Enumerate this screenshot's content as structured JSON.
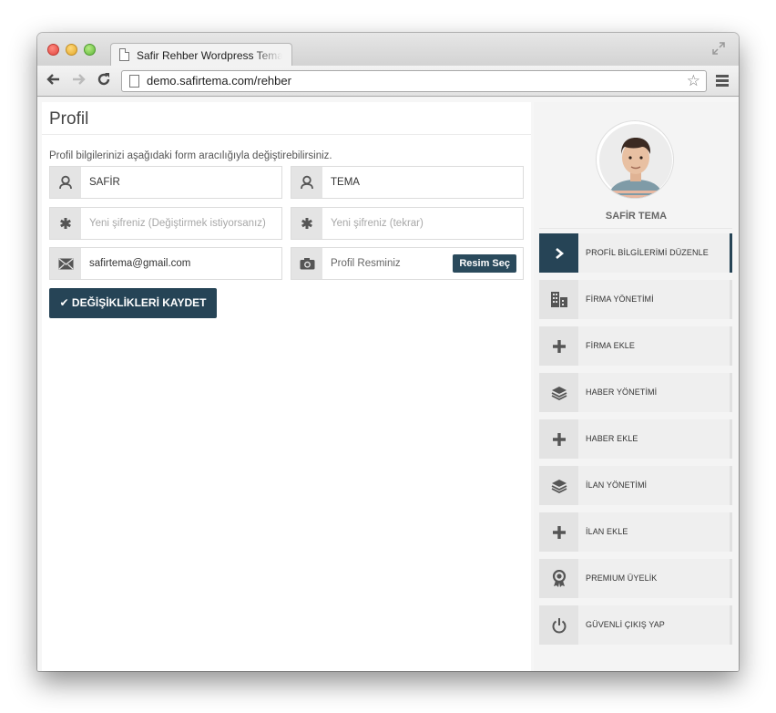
{
  "browser": {
    "tab_title": "Safir Rehber Wordpress Temas",
    "url": "demo.safirtema.com/rehber"
  },
  "profile": {
    "title": "Profil",
    "intro": "Profil bilgilerinizi aşağıdaki form aracılığıyla değiştirebilirsiniz.",
    "first_name": "SAFİR",
    "last_name": "TEMA",
    "password_placeholder": "Yeni şifreniz (Değiştirmek istiyorsanız)",
    "password_repeat_placeholder": "Yeni şifreniz (tekrar)",
    "email": "safirtema@gmail.com",
    "avatar_placeholder": "Profil Resminiz",
    "choose_image_label": "Resim Seç",
    "save_label": "✔ DEĞİŞİKLİKLERİ KAYDET"
  },
  "sidebar": {
    "user_name": "SAFİR TEMA",
    "items": [
      {
        "label": "PROFİL BİLGİLERİMİ DÜZENLE",
        "icon": "chevron-right-icon",
        "active": true
      },
      {
        "label": "FİRMA YÖNETİMİ",
        "icon": "building-icon",
        "active": false
      },
      {
        "label": "FİRMA EKLE",
        "icon": "plus-icon",
        "active": false
      },
      {
        "label": "HABER YÖNETİMİ",
        "icon": "layers-icon",
        "active": false
      },
      {
        "label": "HABER EKLE",
        "icon": "plus-icon",
        "active": false
      },
      {
        "label": "İLAN YÖNETİMİ",
        "icon": "layers-icon",
        "active": false
      },
      {
        "label": "İLAN EKLE",
        "icon": "plus-icon",
        "active": false
      },
      {
        "label": "PREMIUM ÜYELİK",
        "icon": "award-icon",
        "active": false
      },
      {
        "label": "GÜVENLİ ÇIKIŞ YAP",
        "icon": "power-icon",
        "active": false
      }
    ]
  },
  "colors": {
    "accent": "#264456",
    "icon_box": "#e4e4e4"
  }
}
